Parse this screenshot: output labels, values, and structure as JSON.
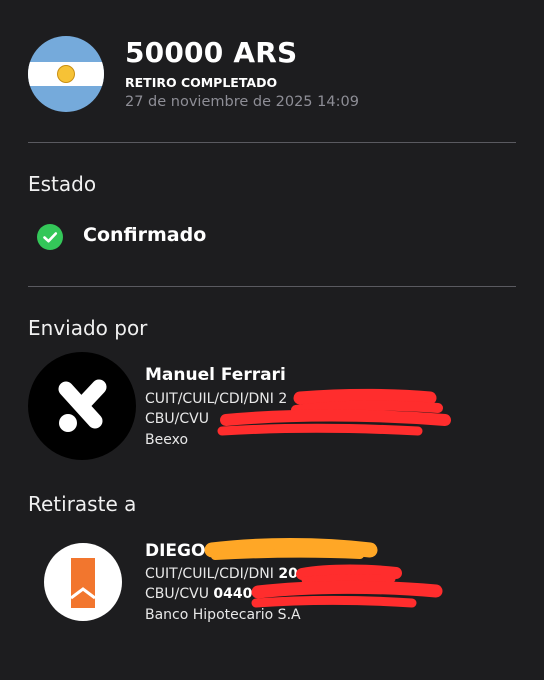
{
  "header": {
    "amount": "50000 ARS",
    "status": "RETIRO COMPLETADO",
    "datetime": "27 de noviembre de 2025 14:09",
    "flag_icon": "argentina-flag-icon"
  },
  "estado": {
    "title": "Estado",
    "value": "Confirmado",
    "icon": "check-circle-icon",
    "color": "#34c759"
  },
  "sender": {
    "section_title": "Enviado por",
    "name": "Manuel Ferrari",
    "id_label": "CUIT/CUIL/CDI/DNI",
    "id_value": "2",
    "account_label": "CBU/CVU",
    "institution": "Beexo",
    "logo_icon": "beexo-logo-icon"
  },
  "recipient": {
    "section_title": "Retiraste a",
    "name": "DIEGO",
    "id_label": "CUIT/CUIL/CDI/DNI",
    "id_value": "20",
    "account_label": "CBU/CVU",
    "account_value": "0440",
    "institution": "Banco Hipotecario S.A",
    "logo_icon": "banco-hipotecario-logo-icon"
  },
  "colors": {
    "background": "#1d1d1f",
    "redaction_red": "#ff2d2d",
    "redaction_orange": "#ffa726",
    "bank_orange": "#f2762e"
  }
}
